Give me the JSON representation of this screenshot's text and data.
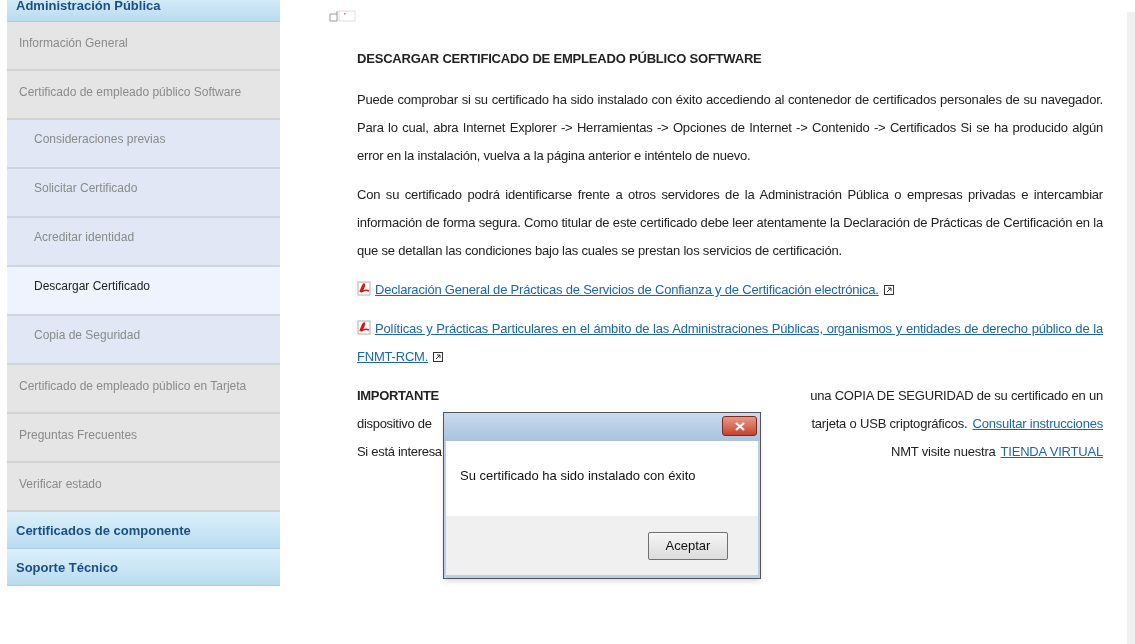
{
  "sidebar": {
    "items": [
      {
        "kind": "header",
        "label": "Administración Pública",
        "selected": false
      },
      {
        "kind": "section",
        "label": "Información General",
        "selected": false
      },
      {
        "kind": "section",
        "label": "Certificado de empleado público Software",
        "selected": false
      },
      {
        "kind": "sub",
        "label": "Consideraciones previas",
        "selected": false
      },
      {
        "kind": "sub",
        "label": "Solicitar Certificado",
        "selected": false
      },
      {
        "kind": "sub",
        "label": "Acreditar identidad",
        "selected": false
      },
      {
        "kind": "sub",
        "label": "Descargar Certificado",
        "selected": true
      },
      {
        "kind": "sub",
        "label": "Copia de Seguridad",
        "selected": false
      },
      {
        "kind": "section",
        "label": "Certificado de empleado público en Tarjeta",
        "selected": false
      },
      {
        "kind": "section",
        "label": "Preguntas Frecuentes",
        "selected": false
      },
      {
        "kind": "section",
        "label": "Verificar estado",
        "selected": false
      },
      {
        "kind": "header",
        "label": "Certificados de componente",
        "selected": false
      },
      {
        "kind": "header",
        "label": "Soporte Técnico",
        "selected": false
      }
    ]
  },
  "content": {
    "title": "DESCARGAR CERTIFICADO DE EMPLEADO PÚBLICO SOFTWARE",
    "paragraphs": [
      "Puede comprobar si su certificado ha sido instalado con éxito accediendo al contenedor de certificados personales de su navegador. Para lo cual, abra Internet Explorer -> Herramientas -> Opciones de Internet -> Contenido -> Certificados Si se ha producido algún error en la instalación, vuelva a la página anterior e inténtelo de nuevo.",
      "Con su certificado podrá identificarse frente a otros servidores de la Administración Pública o empresas privadas e intercambiar información de forma segura. Como titular de este certificado debe leer atentamente la Declaración de Prácticas de Certificación en la que se detallan las condiciones bajo las cuales se prestan los servicios de certificación."
    ],
    "documents": [
      "Declaración General de Prácticas de Servicios de Confianza y de Certificación electrónica.",
      "Políticas y Prácticas Particulares en el ámbito de las Administraciones Públicas, organismos y entidades de derecho público de la FNMT-RCM."
    ],
    "important_lines": [
      {
        "left": "IMPORTANTE",
        "left_bold": true,
        "right": "una COPIA DE SEGURIDAD de su certificado en un"
      },
      {
        "left": "dispositivo de",
        "left_bold": false,
        "right": "tarjeta o USB criptográficos.",
        "link": "Consultar instrucciones"
      },
      {
        "left": "Si está interesa",
        "left_bold": false,
        "right": "NMT visite nuestra",
        "link": "TIENDA VIRTUAL"
      }
    ]
  },
  "dialog": {
    "message": "Su certificado ha sido instalado con éxito",
    "button": "Aceptar"
  }
}
